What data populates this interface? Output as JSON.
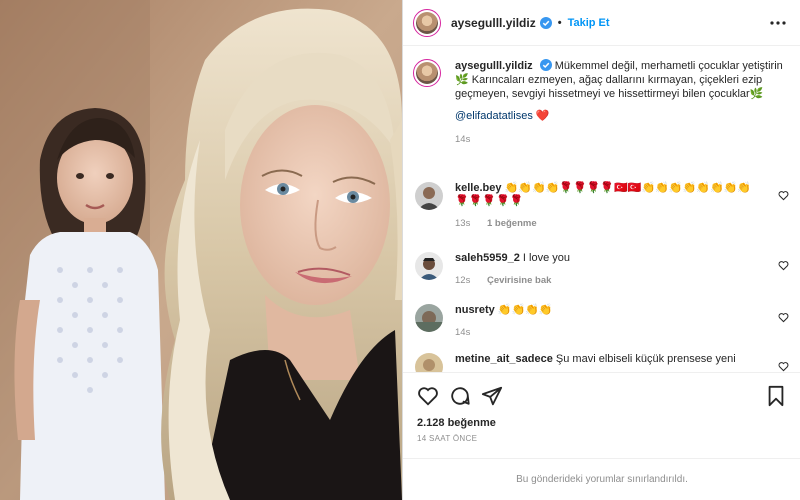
{
  "post": {
    "username": "aysegulll.yildiz",
    "follow_label": "Takip Et",
    "separator": "•"
  },
  "caption": {
    "username": "aysegulll.yildiz",
    "text": "Mükemmel değil, merhametli çocuklar yetiştirin🌿 Karıncaları ezmeyen, ağaç dallarını kırmayan, çiçekleri ezip geçmeyen, sevgiyi hissetmeyi ve hissettirmeyi bilen çocuklar🌿",
    "mention": "@elifadatatlises ❤️",
    "time": "14s"
  },
  "comments": [
    {
      "username": "kelle.bey",
      "text": "👏👏👏👏🌹🌹🌹🌹🇹🇷🇹🇷👏👏👏👏👏👏👏👏🌹🌹🌹🌹🌹",
      "time": "13s",
      "likes": "1 beğenme"
    },
    {
      "username": "saleh5959_2",
      "text": "I love you",
      "time": "12s",
      "translate": "Çevirisine bak"
    },
    {
      "username": "nusrety",
      "text": "👏👏👏👏",
      "time": "14s"
    },
    {
      "username": "metine_ait_sadece",
      "text": "Şu mavi elbiseli küçük prensese yeni"
    }
  ],
  "footer": {
    "likes": "2.128 beğenme",
    "time_ago": "14 SAAT ÖNCE",
    "restricted": "Bu gönderideki yorumlar sınırlandırıldı."
  },
  "colors": {
    "verified": "#3897f0",
    "follow": "#0095f6",
    "mention": "#00376b",
    "muted": "#8e8e8e"
  },
  "icons": [
    "verified-badge-icon",
    "more-options-icon",
    "heart-icon",
    "comment-icon",
    "share-icon",
    "bookmark-icon"
  ]
}
